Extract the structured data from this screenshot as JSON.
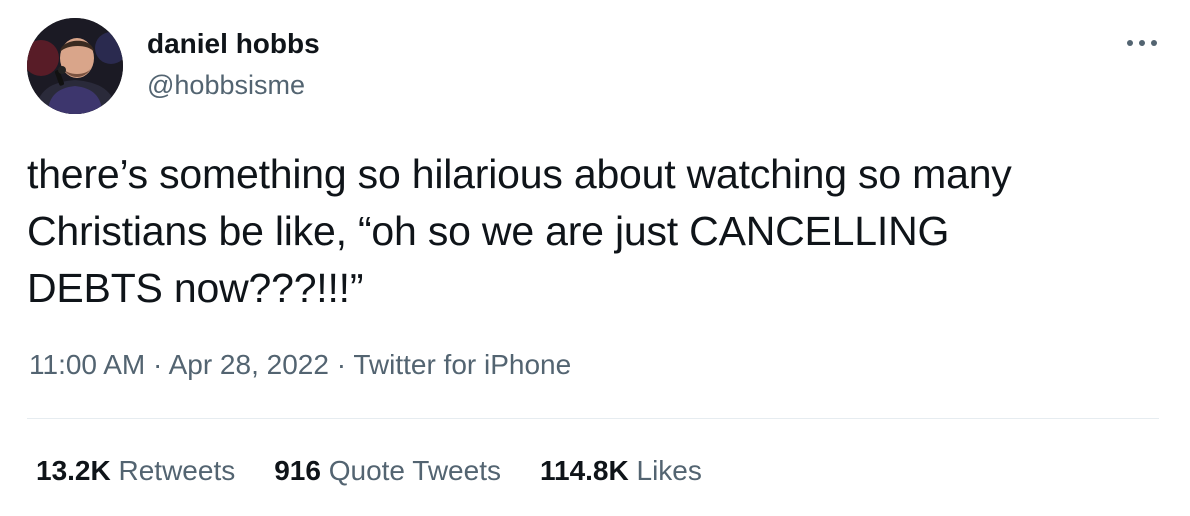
{
  "user": {
    "display_name": "daniel hobbs",
    "handle": "@hobbsisme"
  },
  "tweet": {
    "text_lines": [
      "there’s something so hilarious about watching so many",
      "Christians be like, “oh so we are just CANCELLING",
      "DEBTS now???!!!”"
    ],
    "time": "11:00 AM",
    "date": "Apr 28, 2022",
    "source": "Twitter for iPhone",
    "separator": "·"
  },
  "stats": {
    "retweets": {
      "count": "13.2K",
      "label": "Retweets"
    },
    "quote_tweets": {
      "count": "916",
      "label": "Quote Tweets"
    },
    "likes": {
      "count": "114.8K",
      "label": "Likes"
    }
  },
  "icons": {
    "more": "more-options-icon"
  },
  "colors": {
    "text_primary": "#0f1419",
    "text_secondary": "#536471",
    "divider": "#e6ecf0"
  }
}
